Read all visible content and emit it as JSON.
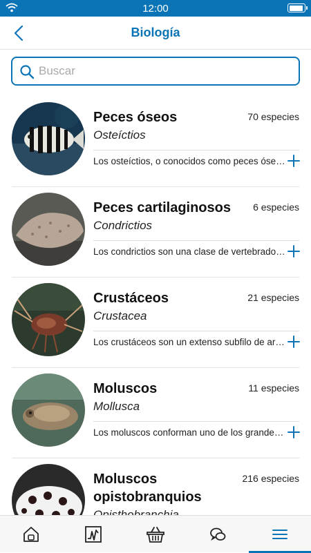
{
  "status_bar": {
    "time": "12:00"
  },
  "nav": {
    "title": "Biología"
  },
  "search": {
    "placeholder": "Buscar"
  },
  "items": [
    {
      "name": "Peces óseos",
      "count": "70 especies",
      "latin": "Osteíctios",
      "description": "Los osteíctios, o conocidos como peces óseos, son una superclase de peces"
    },
    {
      "name": "Peces cartilaginosos",
      "count": "6 especies",
      "latin": "Condrictios",
      "description": "Los condrictios son una clase de vertebrados acuáticos"
    },
    {
      "name": "Crustáceos",
      "count": "21 especies",
      "latin": "Crustacea",
      "description": "Los crustáceos son un extenso subfilo de artrópodos"
    },
    {
      "name": "Moluscos",
      "count": "11 especies",
      "latin": "Mollusca",
      "description": "Los moluscos conforman uno de los grandes filos del reino animal"
    },
    {
      "name": "Moluscos opistobranquios",
      "count": "216 especies",
      "latin": "Opisthobranchia",
      "description": ""
    }
  ],
  "tabs": [
    {
      "icon": "home-icon"
    },
    {
      "icon": "chart-icon"
    },
    {
      "icon": "basket-icon"
    },
    {
      "icon": "chat-icon"
    },
    {
      "icon": "menu-icon",
      "active": true
    }
  ],
  "colors": {
    "accent": "#0a74b6"
  }
}
